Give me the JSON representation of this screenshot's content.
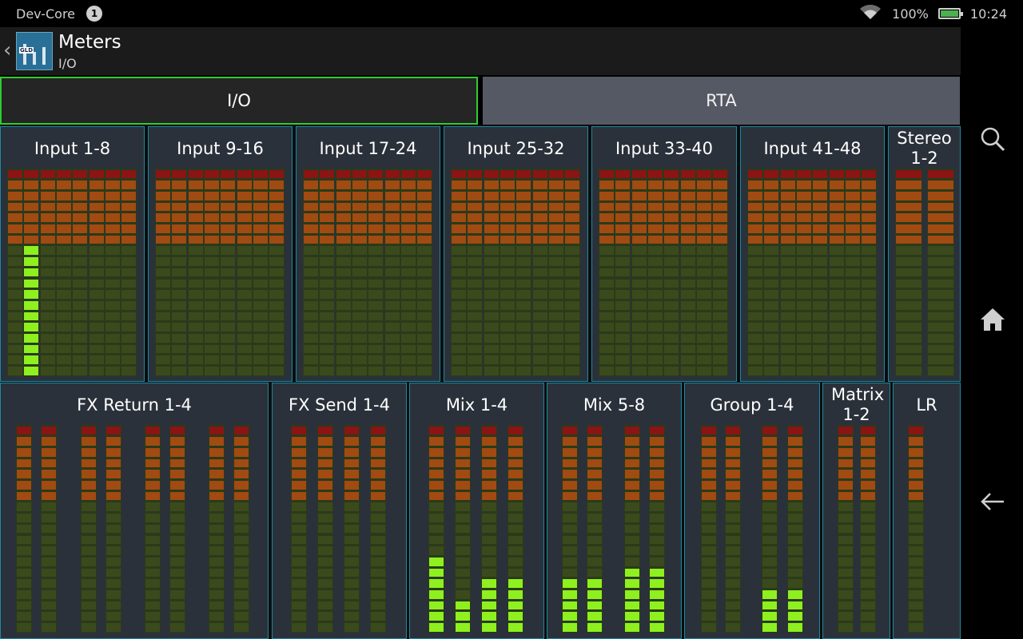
{
  "statusbar": {
    "app_label": "Dev-Core",
    "notification_count": "1",
    "battery": "100%",
    "time": "10:24"
  },
  "header": {
    "title": "Meters",
    "subtitle": "I/O",
    "icon_text": "GLD"
  },
  "tabs": [
    {
      "label": "I/O",
      "active": true
    },
    {
      "label": "RTA",
      "active": false
    }
  ],
  "colors": {
    "accent_active_tab": "#2ecc2e",
    "panel_border": "#1a8aa3",
    "meter_lit": "#8ef01e",
    "meter_red": "#8b1414",
    "meter_orange": "#a14a11"
  },
  "nav_icons": [
    "search-icon",
    "home-icon",
    "back-arrow-icon"
  ],
  "row1_panels": [
    {
      "label": "Input 1-8",
      "levels": [
        0.0,
        12,
        0,
        0,
        0,
        0,
        0,
        0
      ]
    },
    {
      "label": "Input 9-16",
      "levels": [
        0,
        0,
        0,
        0,
        0,
        0,
        0,
        0
      ]
    },
    {
      "label": "Input 17-24",
      "levels": [
        0,
        0,
        0,
        0,
        0,
        0,
        0,
        0
      ]
    },
    {
      "label": "Input 25-32",
      "levels": [
        0,
        0,
        0,
        0,
        0,
        0,
        0,
        0
      ]
    },
    {
      "label": "Input 33-40",
      "levels": [
        0,
        0,
        0,
        0,
        0,
        0,
        0,
        0
      ]
    },
    {
      "label": "Input 41-48",
      "levels": [
        0,
        0,
        0,
        0,
        0,
        0,
        0,
        0
      ]
    },
    {
      "label": "Stereo 1-2",
      "levels": [
        0,
        0
      ]
    }
  ],
  "row2_panels": [
    {
      "label": "FX Return 1-4",
      "levels": [
        0,
        0,
        0,
        0,
        0,
        0,
        0,
        0
      ]
    },
    {
      "label": "FX Send 1-4",
      "levels": [
        0,
        0,
        0,
        0
      ]
    },
    {
      "label": "Mix 1-4",
      "levels": [
        7,
        3,
        5,
        5
      ]
    },
    {
      "label": "Mix 5-8",
      "levels": [
        5,
        5,
        6,
        6
      ]
    },
    {
      "label": "Group 1-4",
      "levels": [
        0,
        0,
        4,
        4
      ]
    },
    {
      "label": "Matrix 1-2",
      "levels": [
        0,
        0
      ]
    },
    {
      "label": "LR",
      "levels": [
        0
      ]
    }
  ]
}
